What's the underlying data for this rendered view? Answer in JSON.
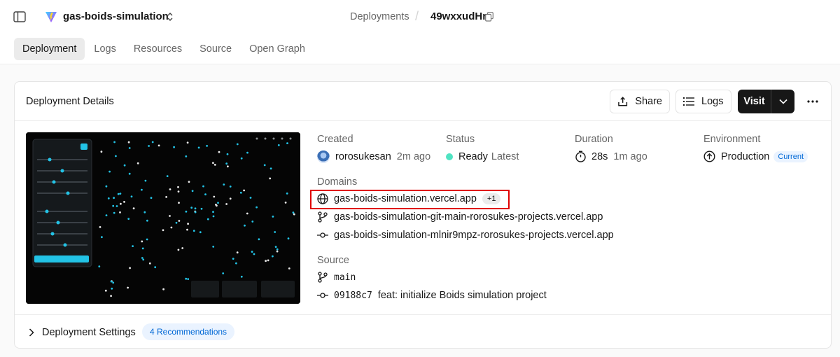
{
  "header": {
    "project_name": "gas-boids-simulation",
    "breadcrumb_parent": "Deployments",
    "breadcrumb_separator": "/",
    "deployment_id": "49wxxudHr"
  },
  "tabs": [
    {
      "label": "Deployment",
      "active": true
    },
    {
      "label": "Logs",
      "active": false
    },
    {
      "label": "Resources",
      "active": false
    },
    {
      "label": "Source",
      "active": false
    },
    {
      "label": "Open Graph",
      "active": false
    }
  ],
  "card": {
    "title": "Deployment Details",
    "share_label": "Share",
    "logs_label": "Logs",
    "visit_label": "Visit"
  },
  "details": {
    "created_label": "Created",
    "created_user": "rorosukesan",
    "created_time": "2m ago",
    "status_label": "Status",
    "status_value": "Ready",
    "status_tag": "Latest",
    "status_color": "#50e3c2",
    "duration_label": "Duration",
    "duration_value": "28s",
    "duration_time": "1m ago",
    "environment_label": "Environment",
    "environment_value": "Production",
    "environment_badge": "Current"
  },
  "domains": {
    "label": "Domains",
    "primary": "gas-boids-simulation.vercel.app",
    "extra_count": "+1",
    "branch": "gas-boids-simulation-git-main-rorosukes-projects.vercel.app",
    "commit": "gas-boids-simulation-mlnir9mpz-rorosukes-projects.vercel.app"
  },
  "source": {
    "label": "Source",
    "branch": "main",
    "commit_hash": "09188c7",
    "commit_message": "feat: initialize Boids simulation project"
  },
  "settings": {
    "label": "Deployment Settings",
    "recommendations": "4 Recommendations"
  },
  "colors": {
    "accent_blue": "#0068d6",
    "highlight_red": "#e00000",
    "boid_cyan": "#22c3e6"
  }
}
